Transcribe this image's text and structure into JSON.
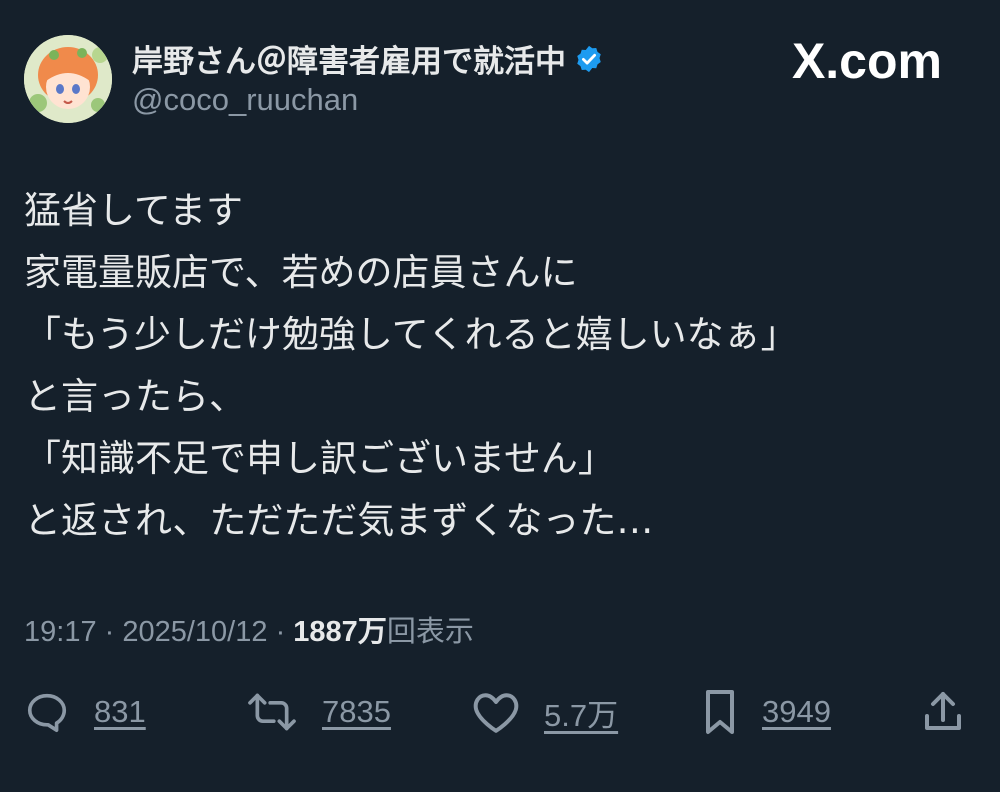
{
  "header": {
    "display_name": "岸野さん＠障害者雇用で就活中",
    "handle": "@coco_ruuchan",
    "brand": "X.com"
  },
  "tweet": {
    "lines": [
      "猛省してます",
      "家電量販店で、若めの店員さんに",
      "「もう少しだけ勉強してくれると嬉しいなぁ」",
      "と言ったら、",
      "「知識不足で申し訳ございません」",
      "と返され、ただただ気まずくなった…"
    ]
  },
  "meta": {
    "time": "19:17",
    "separator": " · ",
    "date": "2025/10/12",
    "views_number": "1887",
    "views_unit": "万",
    "views_label": "回表示"
  },
  "actions": {
    "replies": "831",
    "reposts": "7835",
    "likes": "5.7万",
    "bookmarks": "3949"
  },
  "colors": {
    "background": "#15202b",
    "text": "#e7e9ea",
    "secondary": "#8b98a5",
    "verified": "#1d9bf0"
  },
  "icons": [
    "reply-icon",
    "repost-icon",
    "like-icon",
    "bookmark-icon",
    "share-icon",
    "verified-badge-icon"
  ]
}
